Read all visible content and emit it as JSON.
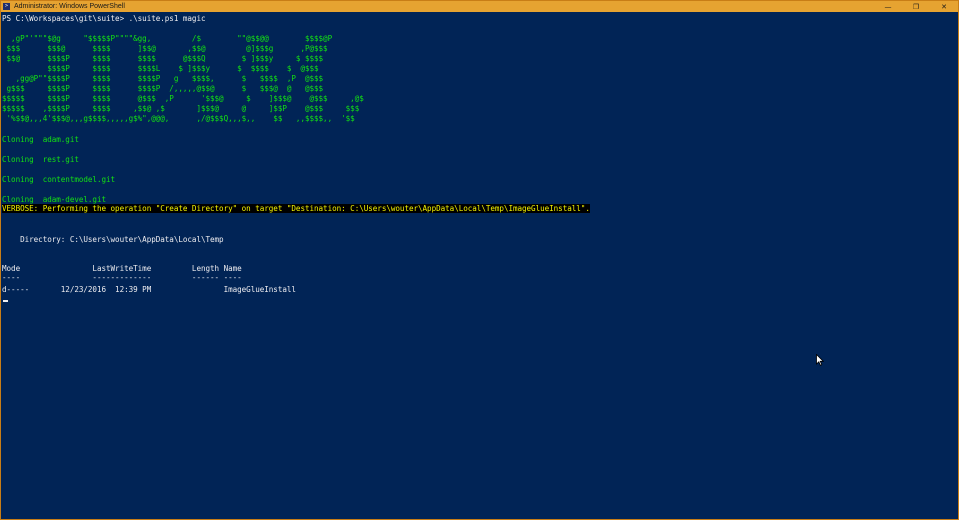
{
  "window": {
    "title": "Administrator: Windows PowerShell",
    "app_icon": "powershell-icon",
    "controls": {
      "minimize": "—",
      "restore": "❐",
      "close": "✕"
    }
  },
  "console": {
    "prompt": "PS C:\\Workspaces\\git\\suite> .\\suite.ps1 magic",
    "banner": [
      "  ,gP\"'\"\"\"$@g     \"$$$$$P\"\"\"\"&gg,         /$        \"\"@$$@@        $$$$@P",
      " $$$      $$$@      $$$$      ]$$@       ,$$@         @]$$$g      ,P@$$$",
      " $$@      $$$$P     $$$$      $$$$      @$$$Q        $ ]$$$y     $ $$$$",
      "          $$$$P     $$$$      $$$$L    $ ]$$$y      $  $$$$    $  @$$$",
      "   ,gg@P\"\"$$$$P     $$$$      $$$$P   g   $$$$,      $   $$$$  ,P  @$$$",
      " g$$$     $$$$P     $$$$      $$$$P  /,,,,,@$$@      $   $$$@  @   @$$$",
      "$$$$$     $$$$P     $$$$      @$$$  ,P      '$$$@     $    ]$$$@    @$$$     ,@$",
      "$$$$$    ,$$$$P     $$$$     ,$$@ ,$       ]$$$@     @     ]$$P    @$$$     $$$",
      " '%$$@,,,4'$$$@,,,g$$$$,,,,,g$%\",@@@,      ,/@$$$Q,,,$,,    $$   ,,$$$$,,  '$$"
    ],
    "clones": [
      "Cloning  adam.git",
      "Cloning  rest.git",
      "Cloning  contentmodel.git",
      "Cloning  adam-devel.git"
    ],
    "verbose": "VERBOSE: Performing the operation \"Create Directory\" on target \"Destination: C:\\Users\\wouter\\AppData\\Local\\Temp\\ImageGlueInstall\".",
    "directory_line": "    Directory: C:\\Users\\wouter\\AppData\\Local\\Temp",
    "table_header": "Mode                LastWriteTime         Length Name",
    "table_rule": "----                -------------         ------ ----",
    "table_row": "d-----       12/23/2016  12:39 PM                ImageGlueInstall"
  },
  "colors": {
    "console_background": "#012456",
    "banner_green": "#13e013",
    "banner_cyan": "#29d6d6",
    "text": "#eeedf0",
    "verbose_text": "#f5f500",
    "titlebar": "#e6a331"
  }
}
